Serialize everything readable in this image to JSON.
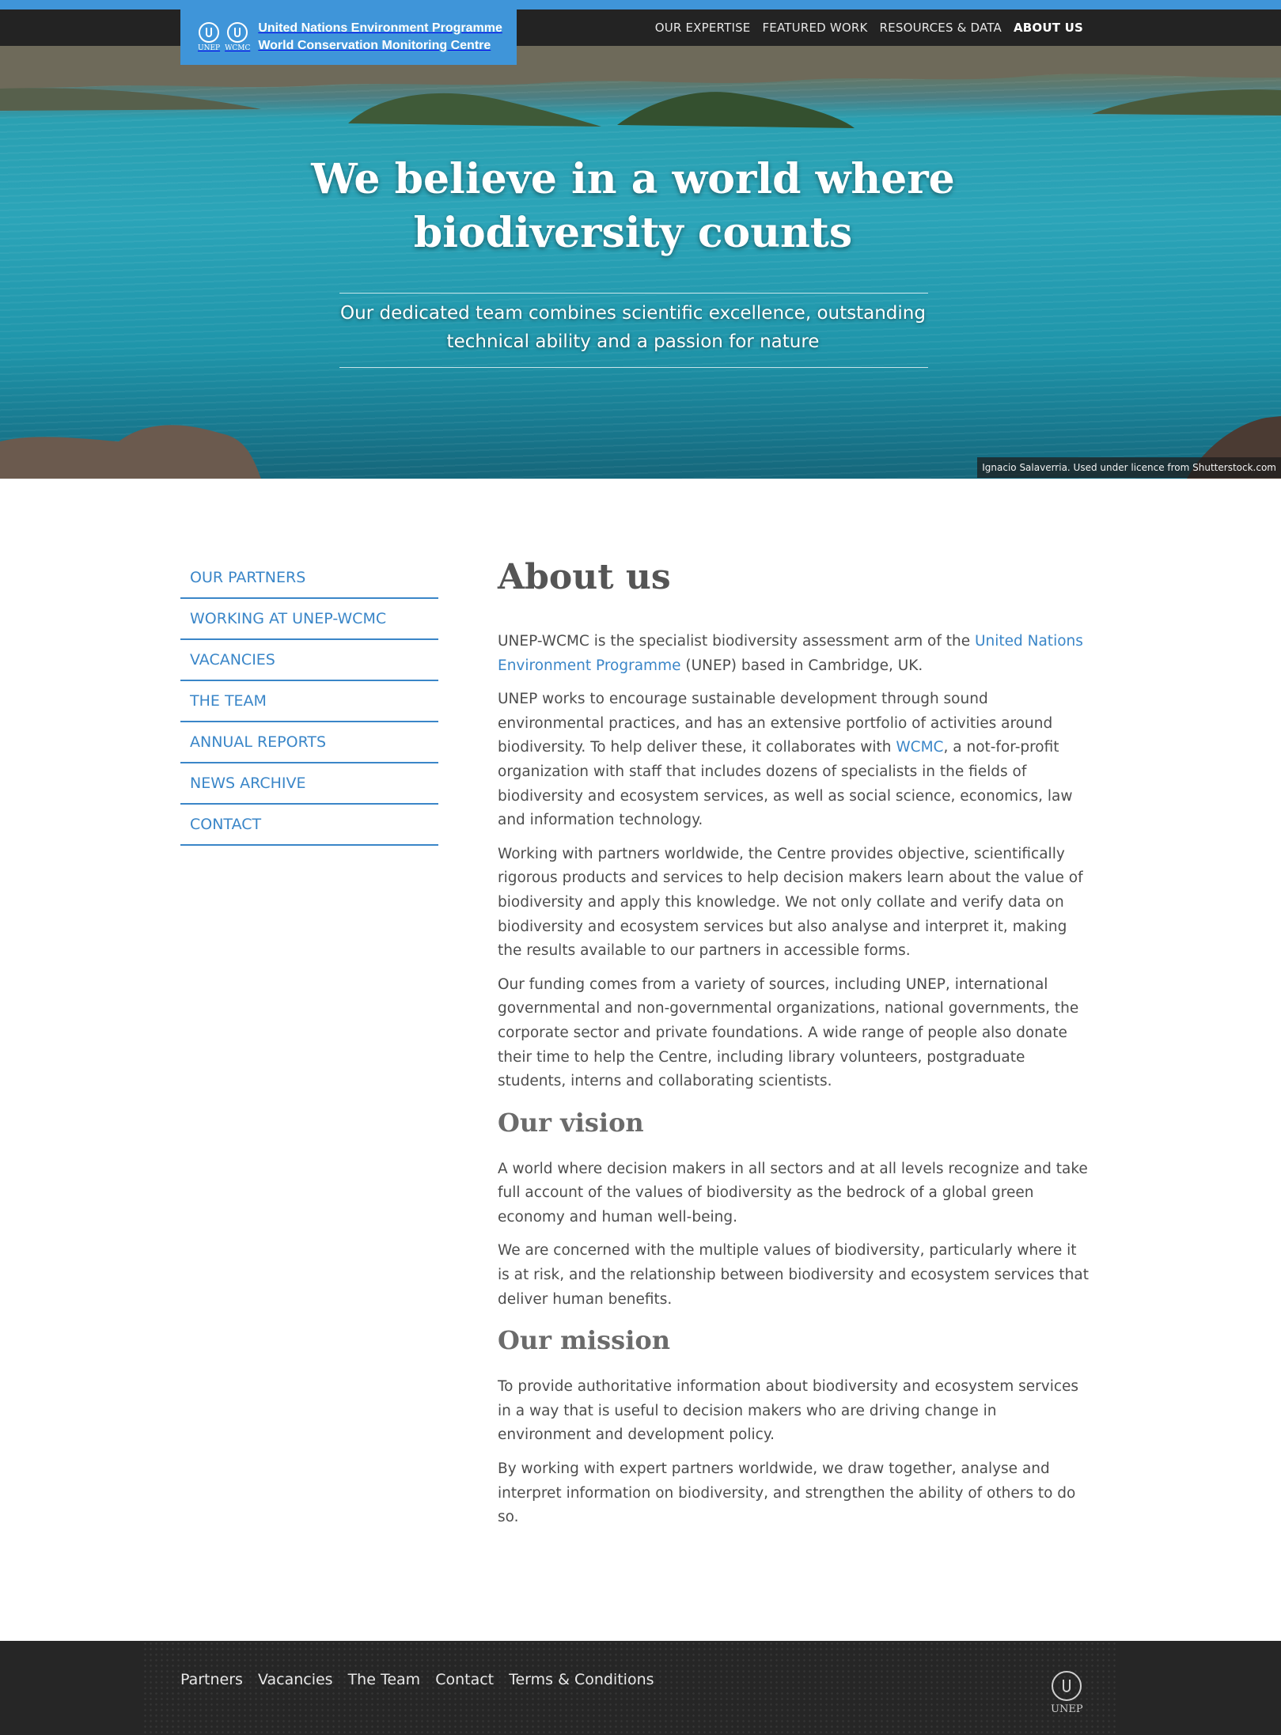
{
  "header": {
    "logo": {
      "line1": "United Nations Environment Programme",
      "line2": "World Conservation Monitoring Centre",
      "emblem_left_caption": "UNEP",
      "emblem_right_caption": "WCMC"
    },
    "nav": [
      {
        "label": "OUR EXPERTISE"
      },
      {
        "label": "FEATURED WORK"
      },
      {
        "label": "RESOURCES & DATA"
      },
      {
        "label": "ABOUT US",
        "active": true
      }
    ]
  },
  "hero": {
    "title_line1": "We believe in a world where",
    "title_line2": "biodiversity counts",
    "subtitle_line1": "Our dedicated team combines scientific excellence, outstanding",
    "subtitle_line2": "technical ability and a passion for nature",
    "photo_credit": "Ignacio Salaverria. Used under licence from Shutterstock.com"
  },
  "sidebar": {
    "items": [
      {
        "label": "OUR PARTNERS"
      },
      {
        "label": "WORKING AT UNEP-WCMC"
      },
      {
        "label": "VACANCIES"
      },
      {
        "label": "THE TEAM"
      },
      {
        "label": "ANNUAL REPORTS"
      },
      {
        "label": "NEWS ARCHIVE"
      },
      {
        "label": "CONTACT"
      }
    ]
  },
  "main": {
    "title": "About us",
    "p1": {
      "before": "UNEP-WCMC is the specialist biodiversity assessment arm of the ",
      "link": "United Nations Environment Programme",
      "after": " (UNEP) based in Cambridge, UK."
    },
    "p2": {
      "before": "UNEP works to encourage sustainable development through sound environmental practices, and has an extensive portfolio of activities around biodiversity. To help deliver these, it collaborates with ",
      "link": "WCMC",
      "after": ", a not-for-profit organization with staff that includes dozens of specialists in the fields of biodiversity and ecosystem services, as well as social science, economics, law and information technology."
    },
    "p3": "Working with partners worldwide, the Centre provides objective, scientifically rigorous products and services to help decision makers learn about the value of biodiversity and apply this knowledge. We not only collate and verify data on biodiversity and ecosystem services but also analyse and interpret it, making the results available to our partners in accessible forms.",
    "p4": "Our funding comes from a variety of sources, including UNEP, international governmental and non-governmental organizations, national governments, the corporate sector and private foundations. A wide range of people also donate their time to help the Centre, including library volunteers, postgraduate students, interns and collaborating scientists.",
    "vision_heading": "Our vision",
    "vision_p1": "A world where decision makers in all sectors and at all levels recognize and take full account of the values of biodiversity as the bedrock of a global green economy and human well-being.",
    "vision_p2": "We are concerned with the multiple values of biodiversity, particularly where it is at risk, and the relationship between biodiversity and ecosystem services that deliver human benefits.",
    "mission_heading": "Our mission",
    "mission_p1": "To provide authoritative information about biodiversity and ecosystem services in a way that is useful to decision makers who are driving change in environment and development policy.",
    "mission_p2": "By working with expert partners worldwide, we draw together, analyse and interpret information on biodiversity, and strengthen the ability of others to do so."
  },
  "footer": {
    "links": [
      {
        "label": "Partners"
      },
      {
        "label": "Vacancies"
      },
      {
        "label": "The Team"
      },
      {
        "label": "Contact"
      },
      {
        "label": "Terms & Conditions"
      }
    ],
    "logo_caption": "UNEP"
  },
  "colors": {
    "accent": "#3f95d9",
    "link": "#3a86c8",
    "nav_bar": "#232323",
    "footer_bg": "#262626",
    "text": "#4d4d4d"
  }
}
